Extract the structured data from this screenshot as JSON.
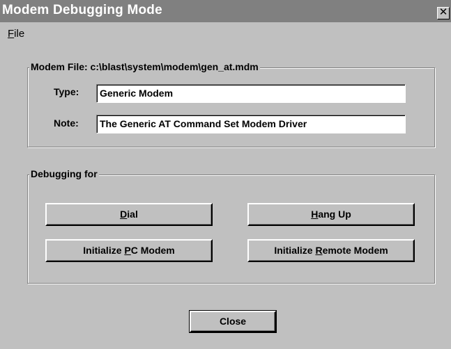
{
  "window": {
    "title": "Modem Debugging Mode",
    "close_glyph": "✕"
  },
  "menu": {
    "file_accel": "F",
    "file_rest": "ile"
  },
  "modem_group": {
    "legend": "Modem File:  c:\\blast\\system\\modem\\gen_at.mdm",
    "type_label": "Type:",
    "type_value": "Generic Modem",
    "note_label": "Note:",
    "note_value": "The Generic AT Command Set Modem Driver"
  },
  "debug_group": {
    "legend": "Debugging for",
    "dial": {
      "pre": "",
      "accel": "D",
      "post": "ial"
    },
    "hangup": {
      "pre": "",
      "accel": "H",
      "post": "ang Up"
    },
    "init_pc": {
      "pre": "Initialize ",
      "accel": "P",
      "post": "C Modem"
    },
    "init_remote": {
      "pre": "Initialize ",
      "accel": "R",
      "post": "emote Modem"
    }
  },
  "footer": {
    "close_label": "Close"
  },
  "colors": {
    "face": "#c0c0c0",
    "title_bar": "#808080",
    "shadow": "#808080",
    "highlight": "#ffffff"
  }
}
